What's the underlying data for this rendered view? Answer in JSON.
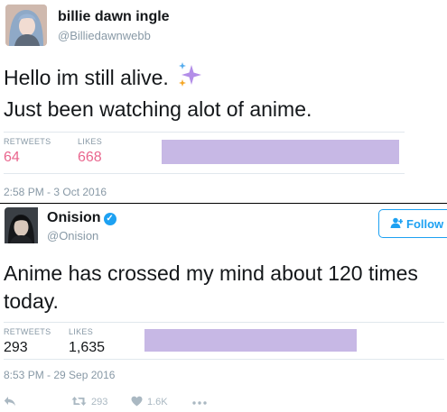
{
  "tweet1": {
    "display_name": "billie dawn ingle",
    "handle": "@Billiedawnwebb",
    "text_line1": "Hello im still alive.",
    "text_line2": "Just been watching alot of anime.",
    "retweets_label": "RETWEETS",
    "retweets_value": "64",
    "likes_label": "LIKES",
    "likes_value": "668",
    "timestamp": "2:58 PM - 3 Oct 2016"
  },
  "tweet2": {
    "display_name": "Onision",
    "handle": "@Onision",
    "follow_label": "Follow",
    "text": "Anime has crossed my mind about 120 times today.",
    "retweets_label": "RETWEETS",
    "retweets_value": "293",
    "likes_label": "LIKES",
    "likes_value": "1,635",
    "timestamp": "8:53 PM - 29 Sep 2016",
    "actions": {
      "retweet_count": "293",
      "like_count": "1.6K"
    }
  },
  "colors": {
    "accent_blue": "#1da1f2",
    "muted_gray": "#8899a6",
    "like_pink": "#e0245e",
    "likers_bar": "#c7b8e5",
    "sparkle_purple": "#b38ee8",
    "sparkle_orange": "#f5a623",
    "sparkle_blue": "#55acee"
  },
  "icons": [
    "sparkles-icon",
    "verified-badge-icon",
    "follow-person-icon",
    "reply-icon",
    "retweet-icon",
    "heart-icon",
    "more-icon"
  ]
}
